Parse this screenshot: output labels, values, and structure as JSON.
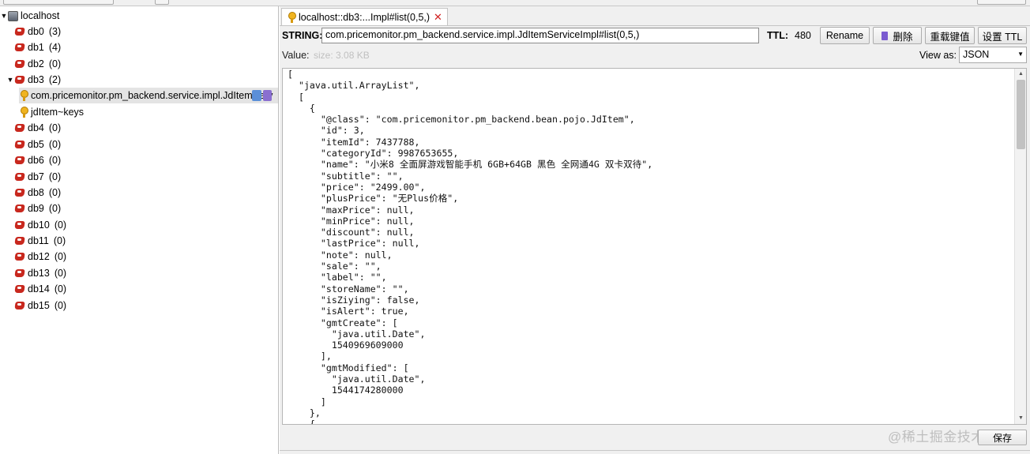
{
  "tree": {
    "host": "localhost",
    "databases": [
      {
        "name": "db0",
        "count": "(3)"
      },
      {
        "name": "db1",
        "count": "(4)"
      },
      {
        "name": "db2",
        "count": "(0)"
      },
      {
        "name": "db3",
        "count": "(2)"
      },
      {
        "name": "db4",
        "count": "(0)"
      },
      {
        "name": "db5",
        "count": "(0)"
      },
      {
        "name": "db6",
        "count": "(0)"
      },
      {
        "name": "db7",
        "count": "(0)"
      },
      {
        "name": "db8",
        "count": "(0)"
      },
      {
        "name": "db9",
        "count": "(0)"
      },
      {
        "name": "db10",
        "count": "(0)"
      },
      {
        "name": "db11",
        "count": "(0)"
      },
      {
        "name": "db12",
        "count": "(0)"
      },
      {
        "name": "db13",
        "count": "(0)"
      },
      {
        "name": "db14",
        "count": "(0)"
      },
      {
        "name": "db15",
        "count": "(0)"
      }
    ],
    "db3_keys": [
      "com.pricemonitor.pm_backend.service.impl.JdItemServ",
      "jdItem~keys"
    ]
  },
  "tab": {
    "label": "localhost::db3:...Impl#list(0,5,)",
    "close": "✕"
  },
  "key_bar": {
    "type_label": "STRING:",
    "key_name": "com.pricemonitor.pm_backend.service.impl.JdItemServiceImpl#list(0,5,)",
    "ttl_label": "TTL:",
    "ttl_value": "480",
    "rename_label": "Rename",
    "delete_label": "删除",
    "reload_label": "重载键值",
    "set_ttl_label": "设置 TTL"
  },
  "value_bar": {
    "value_label": "Value:",
    "size": "size: 3.08 KB",
    "view_as_label": "View as:",
    "view_as_selected": "JSON"
  },
  "editor": {
    "lines": [
      "[",
      "  \"java.util.ArrayList\",",
      "  [",
      "    {",
      "      \"@class\": \"com.pricemonitor.pm_backend.bean.pojo.JdItem\",",
      "      \"id\": 3,",
      "      \"itemId\": 7437788,",
      "      \"categoryId\": 9987653655,",
      "      \"name\": \"小米8 全面屏游戏智能手机 6GB+64GB 黑色 全网通4G 双卡双待\",",
      "      \"subtitle\": \"\",",
      "      \"price\": \"2499.00\",",
      "      \"plusPrice\": \"无Plus价格\",",
      "      \"maxPrice\": null,",
      "      \"minPrice\": null,",
      "      \"discount\": null,",
      "      \"lastPrice\": null,",
      "      \"note\": null,",
      "      \"sale\": \"\",",
      "      \"label\": \"\",",
      "      \"storeName\": \"\",",
      "      \"isZiying\": false,",
      "      \"isAlert\": true,",
      "      \"gmtCreate\": [",
      "        \"java.util.Date\",",
      "        1540969609000",
      "      ],",
      "      \"gmtModified\": [",
      "        \"java.util.Date\",",
      "        1544174280000",
      "      ]",
      "    },",
      "    {"
    ]
  },
  "save_label": "保存",
  "watermark": "@稀土掘金技术社区",
  "colors": {
    "redis_red": "#c8281e",
    "key_gold": "#f0b420",
    "close_red": "#d02020",
    "selected_row": "#e4e4e4"
  },
  "icons": [
    "redis-db-icon",
    "key-icon",
    "server-icon",
    "trash-icon",
    "close-icon",
    "chevron-down-icon"
  ]
}
